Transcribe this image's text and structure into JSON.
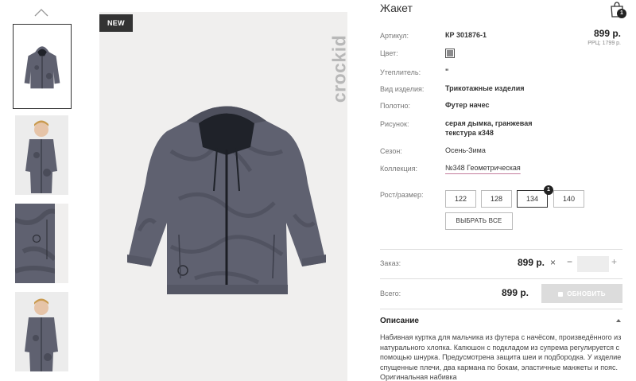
{
  "product": {
    "title": "Жакет",
    "badge": "NEW",
    "brand": "crockid",
    "price": "899 р.",
    "rrp": "РРЦ: 1799 р.",
    "cart_count": "1"
  },
  "attributes": [
    {
      "label": "Артикул:",
      "value": "КР 301876-1"
    },
    {
      "label": "Цвет:",
      "value_color": "#8a8a8c"
    },
    {
      "label": "Утеплитель:",
      "value": "\""
    },
    {
      "label": "Вид изделия:",
      "value": "Трикотажные изделия"
    },
    {
      "label": "Полотно:",
      "value": "Футер начес"
    },
    {
      "label": "Рисунок:",
      "value_line1": "серая дымка, гранжевая",
      "value_line2": "текстура к348"
    },
    {
      "label": "Сезон:",
      "value": "Осень-Зима"
    },
    {
      "label": "Коллекция:",
      "value": "№348 Геометрическая"
    }
  ],
  "sizes": {
    "label": "Рост/размер:",
    "options": [
      "122",
      "128",
      "134",
      "140"
    ],
    "selected": "134",
    "selected_count": "1",
    "select_all": "ВЫБРАТЬ ВСЕ"
  },
  "order": {
    "label": "Заказ:",
    "price": "899 р.",
    "times": "×",
    "minus": "−",
    "plus": "+",
    "quantity": ""
  },
  "total": {
    "label": "Всего:",
    "price": "899 р.",
    "update_button": "ОБНОВИТЬ"
  },
  "description": {
    "title": "Описание",
    "text": "Набивная куртка для мальчика из футера с начёсом, произведённого из натурального хлопка. Капюшон с подкладом из супрема регулируется с помощью шнурка. Предусмотрена защита шеи и подбородка. У изделие спущенные плечи, два кармана по бокам, эластичные манжеты и пояс. Оригинальная набивка"
  },
  "colors": {
    "jacket": "#5f6170",
    "jacket_dark": "#3c3e4a",
    "hood_lining": "#1f2229",
    "image_bg": "#f0efee",
    "accent_underline": "#c47d9c"
  },
  "icons": [
    "chevron-up-icon",
    "shopping-bag-icon",
    "chevron-up-small-icon",
    "bag-icon"
  ]
}
